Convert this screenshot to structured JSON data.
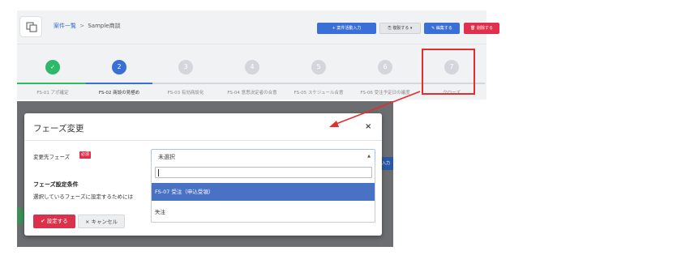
{
  "header": {
    "breadcrumb_link": "案件一覧",
    "breadcrumb_sep": ">",
    "breadcrumb_current": "Sample商談",
    "btn_activity": "+ 案件活動入力",
    "btn_duplicate": "⎘ 複製する ▾",
    "btn_edit": "✎ 編集する",
    "btn_delete": "🗑 削除する"
  },
  "stepper": {
    "steps": [
      {
        "number": "✓",
        "label": "FS-01 アポ確定",
        "state": "done"
      },
      {
        "number": "2",
        "label": "FS-02 商談の見極め",
        "state": "active"
      },
      {
        "number": "3",
        "label": "FS-03 有効商談化",
        "state": "todo"
      },
      {
        "number": "4",
        "label": "FS-04 意思決定者の合意",
        "state": "todo"
      },
      {
        "number": "5",
        "label": "FS-05 スケジュール合意",
        "state": "todo"
      },
      {
        "number": "6",
        "label": "FS-06 受注予定日の確度",
        "state": "todo"
      },
      {
        "number": "7",
        "label": "クローズ",
        "state": "todo"
      }
    ],
    "colors": {
      "done": "#2fb86a",
      "active": "#3b6fd8",
      "todo": "#d3d6da"
    }
  },
  "modal": {
    "title": "フェーズ変更",
    "close": "×",
    "field_label": "変更先フェーズ",
    "required_badge": "必須",
    "select_value": "未選択",
    "select_arrow": "▲",
    "condition_title": "フェーズ設定条件",
    "condition_text": "選択しているフェーズに設定するためには",
    "submit": "✔ 設定する",
    "cancel": "× キャンセル"
  },
  "dropdown": {
    "search_value": "",
    "options": [
      {
        "label": "FS-07 受注（申込受領）",
        "selected": true
      },
      {
        "label": "失注",
        "selected": false
      }
    ]
  },
  "background_fragment": {
    "blue_text": "入力"
  },
  "annotation": {
    "color": "#e52d2d"
  }
}
